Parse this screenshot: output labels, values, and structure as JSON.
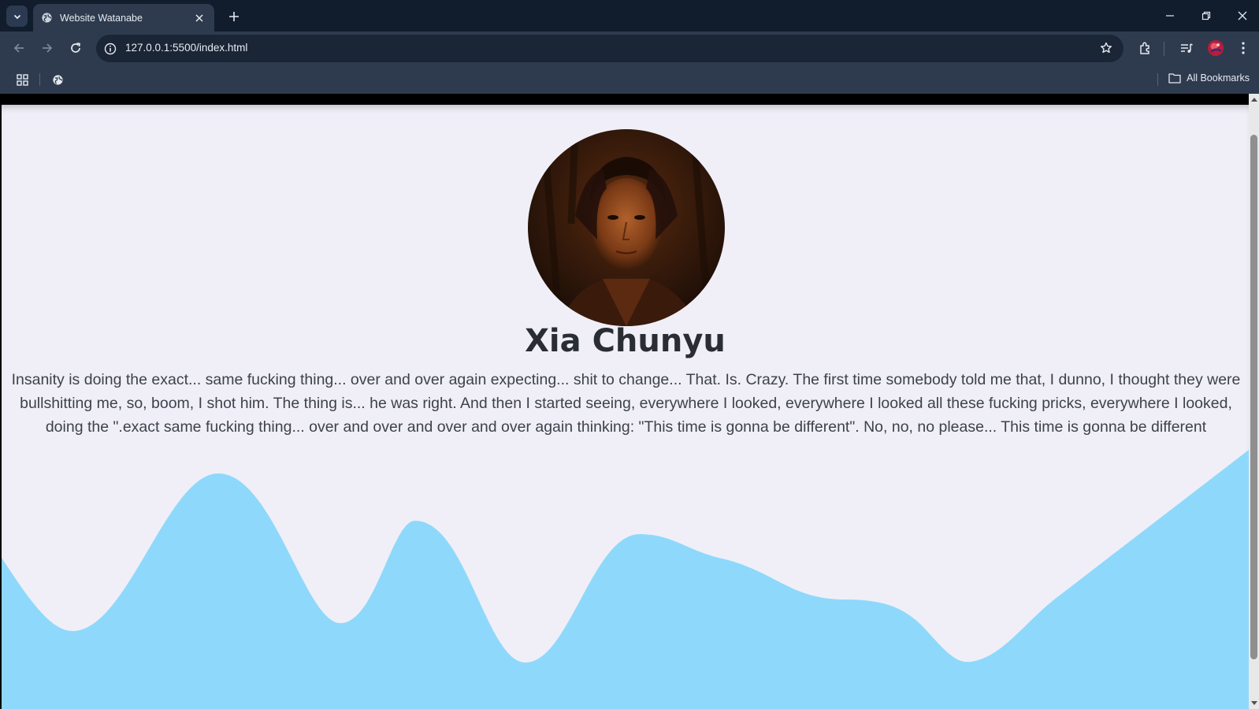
{
  "browser": {
    "tab_title": "Website Watanabe",
    "url": "127.0.0.1:5500/index.html",
    "all_bookmarks_label": "All Bookmarks"
  },
  "profile": {
    "name": "Xia Chunyu",
    "quote": "Insanity is doing the exact... same fucking thing... over and over again expecting... shit to change... That. Is. Crazy. The first time somebody told me that, I dunno, I thought they were bullshitting me, so, boom, I shot him. The thing is... he was right. And then I started seeing, everywhere I looked, everywhere I looked all these fucking pricks, everywhere I looked, doing the \".exact same fucking thing... over and over and over and over again thinking: \"This time is gonna be different\". No, no, no please... This time is gonna be different"
  },
  "colors": {
    "page_background": "#f0eff8",
    "wave": "#8ed9fb",
    "chrome_dark": "#111c2d",
    "chrome": "#2e3b4f"
  }
}
